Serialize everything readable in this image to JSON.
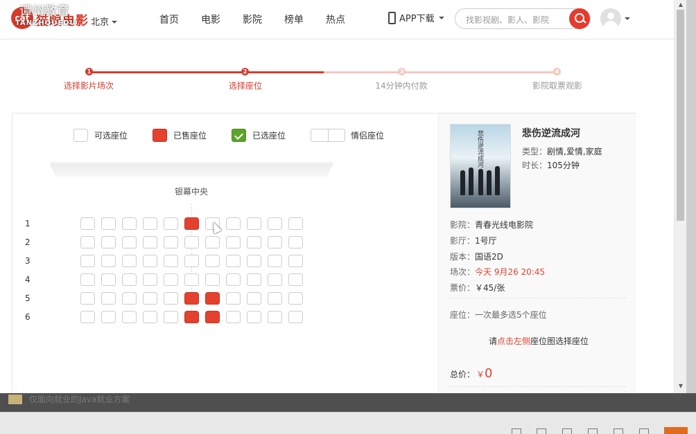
{
  "header": {
    "logo_badge": "cat",
    "logo_text": "猫眼电影",
    "logo_sub": "TANZHOUEDU",
    "watermark": "谭州教育",
    "city": "北京",
    "nav": [
      "首页",
      "电影",
      "影院",
      "榜单",
      "热点"
    ],
    "app_download": "APP下载",
    "search_placeholder": "找影视剧、影人、影院"
  },
  "steps": [
    {
      "num": "1",
      "label": "选择影片场次",
      "state": "done"
    },
    {
      "num": "2",
      "label": "选择座位",
      "state": "active"
    },
    {
      "num": "3",
      "label": "14分钟内付款",
      "state": "todo"
    },
    {
      "num": "4",
      "label": "影院取票观影",
      "state": "todo"
    }
  ],
  "legend": {
    "available": "可选座位",
    "sold": "已售座位",
    "selected": "已选座位",
    "couple": "情侣座位"
  },
  "screen_label": "银幕中央",
  "rows": [
    {
      "num": "1",
      "seats": [
        "a",
        "a",
        "a",
        "a",
        "a",
        "s",
        "a",
        "a",
        "a",
        "a",
        "a"
      ]
    },
    {
      "num": "2",
      "seats": [
        "a",
        "a",
        "a",
        "a",
        "a",
        "a",
        "a",
        "a",
        "a",
        "a",
        "a"
      ]
    },
    {
      "num": "3",
      "seats": [
        "a",
        "a",
        "a",
        "a",
        "a",
        "a",
        "a",
        "a",
        "a",
        "a",
        "a"
      ]
    },
    {
      "num": "4",
      "seats": [
        "a",
        "a",
        "a",
        "a",
        "a",
        "a",
        "a",
        "a",
        "a",
        "a",
        "a"
      ]
    },
    {
      "num": "5",
      "seats": [
        "a",
        "a",
        "a",
        "a",
        "a",
        "s",
        "s",
        "a",
        "a",
        "a",
        "a"
      ]
    },
    {
      "num": "6",
      "seats": [
        "a",
        "a",
        "a",
        "a",
        "a",
        "s",
        "s",
        "a",
        "a",
        "a",
        "a"
      ]
    }
  ],
  "movie": {
    "poster_text": "悲伤逆流成河",
    "title": "悲伤逆流成河",
    "type_label": "类型：",
    "type_value": "剧情,爱情,家庭",
    "duration_label": "时长：",
    "duration_value": "105分钟"
  },
  "show": {
    "cinema_label": "影院：",
    "cinema_value": "青春光线电影院",
    "hall_label": "影厅：",
    "hall_value": "1号厅",
    "version_label": "版本：",
    "version_value": "国语2D",
    "time_label": "场次：",
    "time_value": "今天 9月26 20:45",
    "price_label": "票价：",
    "price_value": "￥45/张",
    "seat_label": "座位：",
    "seat_value": "一次最多选5个座位",
    "tip_prefix": "请",
    "tip_highlight": "点击左侧",
    "tip_suffix": "座位图选择座位",
    "total_label": "总价：",
    "total_currency": "￥",
    "total_value": "0"
  },
  "bottom": {
    "task_text": "仅面向就业的Java就业方案"
  },
  "colors": {
    "accent": "#e4412f",
    "selected": "#5ca42c",
    "step_inactive": "#f7c6c0"
  }
}
